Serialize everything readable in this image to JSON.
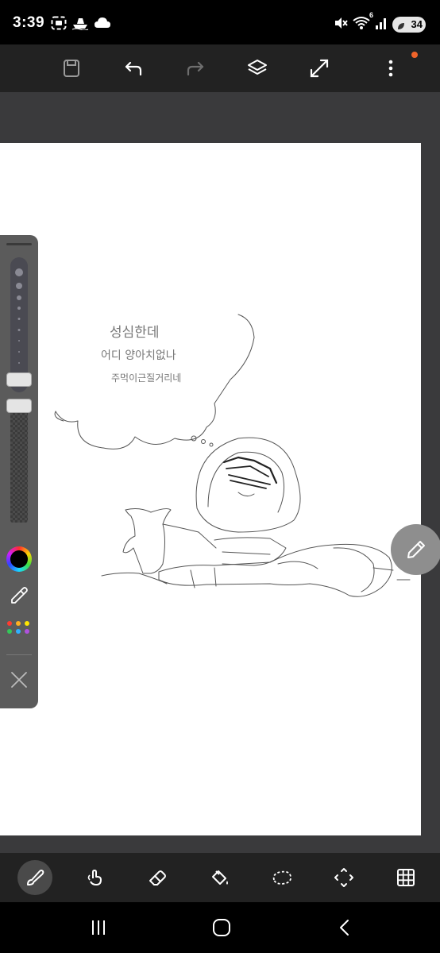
{
  "status_bar": {
    "time": "3:39",
    "battery_level": "34",
    "network_badge": "6",
    "left_icons": [
      "screenshot-icon",
      "boat-icon",
      "cloud-icon"
    ],
    "right_icons": [
      "mute-icon",
      "wifi-icon",
      "signal-icon",
      "battery-icon"
    ]
  },
  "top_toolbar": {
    "buttons": [
      "save-icon",
      "undo-icon",
      "redo-icon",
      "layers-icon",
      "fullscreen-icon",
      "more-icon"
    ],
    "notification_color": "#f0642a"
  },
  "side_panel": {
    "brush_size_level": 0.28,
    "opacity_level": 0.1,
    "current_color": "#000000",
    "palette_colors": [
      "#ff3b30",
      "#ffb020",
      "#ffe600",
      "#34c759",
      "#30b0ff",
      "#af52de"
    ]
  },
  "bottom_toolbar": {
    "tools": [
      "brush-icon",
      "smudge-icon",
      "eraser-icon",
      "fill-icon",
      "lasso-icon",
      "transform-icon",
      "grid-icon"
    ],
    "active_tool": "brush-icon"
  },
  "canvas": {
    "background": "#ffffff",
    "handwritten_text": [
      "성심한데",
      "어디 양아치없나",
      "주먹이근질거리네"
    ]
  },
  "nav_bar": {
    "buttons": [
      "recents-icon",
      "home-icon",
      "back-icon"
    ]
  }
}
